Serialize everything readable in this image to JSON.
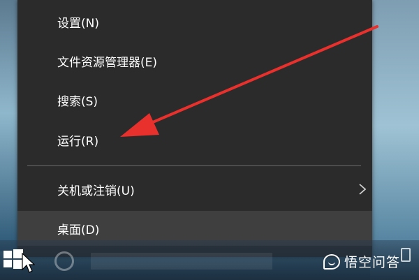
{
  "menu": {
    "items": [
      {
        "label": "设置(N)"
      },
      {
        "label": "文件资源管理器(E)"
      },
      {
        "label": "搜索(S)"
      },
      {
        "label": "运行(R)"
      },
      {
        "label": "关机或注销(U)"
      },
      {
        "label": "桌面(D)"
      }
    ]
  },
  "watermark": {
    "text": "悟空问答"
  },
  "colors": {
    "menu_bg": "#2b2b2b",
    "highlight": "#3f3f3f",
    "arrow": "#e8302c"
  },
  "icons": [
    "chevron-right-icon",
    "windows-logo-icon",
    "cortana-icon",
    "mouse-cursor-icon",
    "chat-bubble-icon"
  ]
}
